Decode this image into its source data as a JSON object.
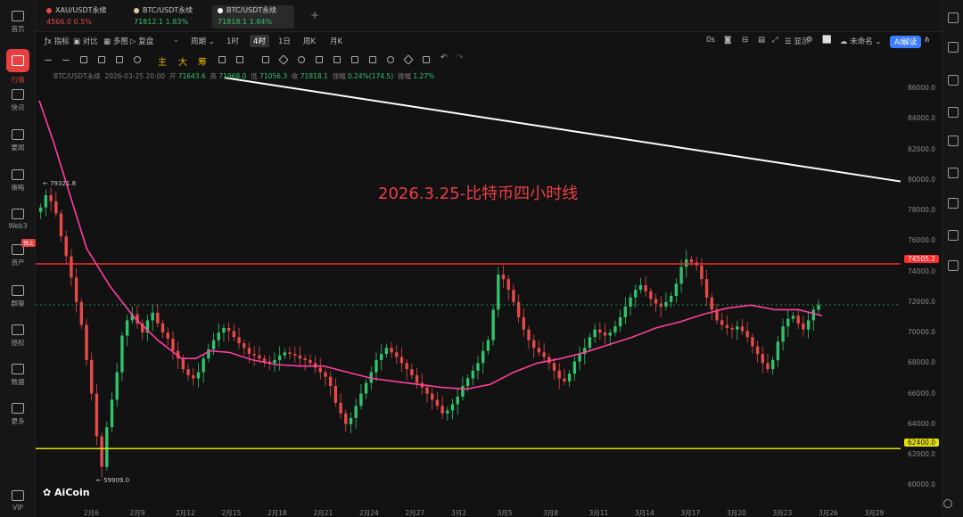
{
  "nav": {
    "items": [
      {
        "label": "首页",
        "icon": "home-icon"
      },
      {
        "label": "行情",
        "icon": "market-icon",
        "active": true
      },
      {
        "label": "快讯",
        "icon": "flash-news-icon"
      },
      {
        "label": "要闻",
        "icon": "news-icon"
      },
      {
        "label": "策略",
        "icon": "strategy-icon"
      },
      {
        "label": "Web3",
        "icon": "web3-icon"
      },
      {
        "label": "资产",
        "icon": "assets-icon",
        "badge": "领上"
      },
      {
        "label": "群聊",
        "icon": "chat-icon"
      },
      {
        "label": "授权",
        "icon": "auth-icon"
      },
      {
        "label": "数据",
        "icon": "data-icon"
      },
      {
        "label": "更多",
        "icon": "more-icon"
      },
      {
        "label": "VIP",
        "icon": "vip-icon"
      }
    ]
  },
  "tabs": [
    {
      "name": "XAU/USDT永续",
      "price": "4566.0",
      "change": "0.5%",
      "dir": "down"
    },
    {
      "name": "BTC/USDT永续",
      "price": "71812.1",
      "change": "1.83%",
      "dir": "up"
    },
    {
      "name": "BTC/USDT永续",
      "price": "71818.1",
      "change": "1.84%",
      "dir": "up",
      "active": true
    }
  ],
  "toolbar1": {
    "indicators": "指标",
    "compare": "对比",
    "multi_chart": "多图",
    "replay": "复盘",
    "period": "周期",
    "intervals": [
      "1时",
      "4时",
      "1日",
      "周K",
      "月K"
    ],
    "active_interval": "4时",
    "countdown": "0s",
    "display": "显示",
    "layout_name": "未命名",
    "ai": "AI解读"
  },
  "toolbar2": {
    "main": "主",
    "large": "大",
    "chips": "筹"
  },
  "ohlc": {
    "symbol": "BTC/USDT永续",
    "time": "2026-03-25 20:00",
    "open_label": "开",
    "open": "71643.6",
    "high_label": "高",
    "high": "71968.0",
    "low_label": "低",
    "low": "71056.3",
    "close_label": "收",
    "close": "71818.1",
    "change_label": "涨幅",
    "change": "0.24%(174.5)",
    "amplitude_label": "振幅",
    "amplitude": "1.27%"
  },
  "annotation": "2026.3.25-比特币四小时线",
  "logo": "AiCoin",
  "levels": {
    "resistance": "74505.2",
    "support": "62400.0",
    "high_callout": "79321.8",
    "low_callout": "59909.0"
  },
  "colors": {
    "resistance": "#ff2a2a",
    "support": "#e6e000",
    "ma": "#ff3fa0",
    "trendline": "#ffffff",
    "up": "#33c26b",
    "down": "#e64a4a",
    "annotation": "#ee3e48"
  },
  "chart_data": {
    "type": "candlestick",
    "y_axis_ticks": [
      "86000.0",
      "84000.0",
      "82000.0",
      "80000.0",
      "78000.0",
      "76000.0",
      "74000.0",
      "72000.0",
      "70000.0",
      "68000.0",
      "66000.0",
      "64000.0",
      "62000.0",
      "60000.0"
    ],
    "ylim": [
      59200,
      87000
    ],
    "x_ticks": [
      "2月6",
      "2月9",
      "2月12",
      "2月15",
      "2月18",
      "2月21",
      "2月24",
      "2月27",
      "3月2",
      "3月5",
      "3月8",
      "3月11",
      "3月14",
      "3月17",
      "3月20",
      "3月23",
      "3月26",
      "3月29"
    ],
    "last_price": 71818.1,
    "ma_line": [
      [
        0,
        85200
      ],
      [
        6,
        82500
      ],
      [
        12,
        79500
      ],
      [
        20,
        75500
      ],
      [
        30,
        73000
      ],
      [
        40,
        71000
      ],
      [
        50,
        69500
      ],
      [
        60,
        68300
      ],
      [
        66,
        68300
      ],
      [
        72,
        68800
      ],
      [
        80,
        68700
      ],
      [
        90,
        68200
      ],
      [
        100,
        67900
      ],
      [
        110,
        67800
      ],
      [
        120,
        67800
      ],
      [
        130,
        67400
      ],
      [
        140,
        67000
      ],
      [
        150,
        66800
      ],
      [
        160,
        66600
      ],
      [
        170,
        66400
      ],
      [
        180,
        66300
      ],
      [
        190,
        66600
      ],
      [
        200,
        67400
      ],
      [
        210,
        68000
      ],
      [
        220,
        68300
      ],
      [
        230,
        68700
      ],
      [
        240,
        69200
      ],
      [
        250,
        69700
      ],
      [
        260,
        70300
      ],
      [
        270,
        70700
      ],
      [
        280,
        71200
      ],
      [
        290,
        71600
      ],
      [
        300,
        71800
      ],
      [
        310,
        71500
      ],
      [
        320,
        71500
      ],
      [
        330,
        71100
      ]
    ],
    "trendline": [
      [
        78,
        86700
      ],
      [
        330,
        79900
      ]
    ],
    "candles_close": [
      78200,
      79000,
      78600,
      77800,
      76300,
      75000,
      73600,
      72000,
      70500,
      68200,
      66000,
      63200,
      61200,
      63800,
      65600,
      67400,
      69800,
      70800,
      71200,
      70600,
      70000,
      70800,
      71300,
      70600,
      70000,
      69600,
      68800,
      68300,
      67600,
      67200,
      67000,
      67400,
      68300,
      68900,
      69500,
      70000,
      70300,
      70100,
      69700,
      69300,
      69000,
      68600,
      68500,
      68300,
      68100,
      68000,
      68200,
      68500,
      68700,
      68600,
      68500,
      68300,
      68200,
      68000,
      67700,
      67400,
      67100,
      66500,
      65400,
      64700,
      64000,
      64400,
      65200,
      66000,
      66700,
      67400,
      68200,
      68600,
      69000,
      68700,
      68400,
      68000,
      67600,
      67200,
      66700,
      66400,
      66000,
      65600,
      65200,
      64700,
      64900,
      65300,
      65800,
      66500,
      67000,
      67500,
      68000,
      68800,
      69500,
      71500,
      73800,
      73500,
      72800,
      72000,
      71000,
      70200,
      69500,
      69000,
      68700,
      68400,
      68000,
      67500,
      67000,
      66800,
      67300,
      68100,
      68600,
      69000,
      69700,
      70200,
      70000,
      69800,
      70000,
      70400,
      71000,
      71700,
      72300,
      72800,
      73100,
      72700,
      72200,
      71900,
      71700,
      72000,
      72400,
      73200,
      74300,
      74800,
      74600,
      74400,
      73500,
      72300,
      71500,
      70800,
      70500,
      70300,
      70200,
      70400,
      70100,
      69700,
      69100,
      68600,
      68000,
      67600,
      68200,
      69400,
      70400,
      70900,
      71100,
      70600,
      70200,
      70800,
      71500,
      71800
    ]
  }
}
